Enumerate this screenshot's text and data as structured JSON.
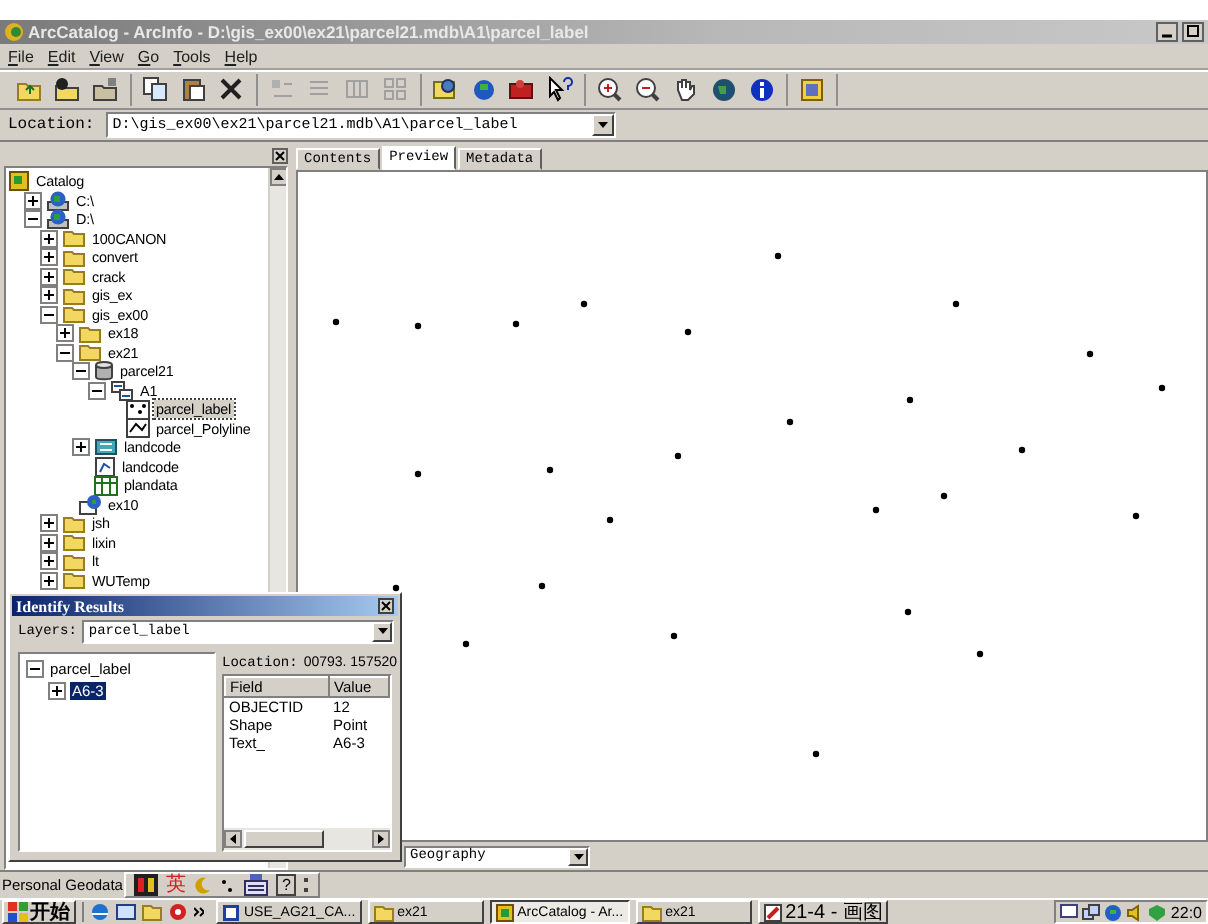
{
  "window": {
    "title": "ArcCatalog - ArcInfo - D:\\gis_ex00\\ex21\\parcel21.mdb\\A1\\parcel_label"
  },
  "menu": [
    "File",
    "Edit",
    "View",
    "Go",
    "Tools",
    "Help"
  ],
  "location": {
    "label": "Location:",
    "value": "D:\\gis_ex00\\ex21\\parcel21.mdb\\A1\\parcel_label"
  },
  "tree": [
    {
      "label": "Catalog",
      "kind": "catalog",
      "selected": false,
      "children": [
        {
          "label": "C:\\",
          "kind": "drive",
          "expanded": false,
          "selected": false
        },
        {
          "label": "D:\\",
          "kind": "drive",
          "expanded": true,
          "selected": false,
          "children": [
            {
              "label": "100CANON",
              "kind": "folder",
              "expanded": false,
              "selected": false
            },
            {
              "label": "convert",
              "kind": "folder",
              "expanded": false,
              "selected": false
            },
            {
              "label": "crack",
              "kind": "folder",
              "expanded": false,
              "selected": false
            },
            {
              "label": "gis_ex",
              "kind": "folder",
              "expanded": false,
              "selected": false
            },
            {
              "label": "gis_ex00",
              "kind": "folder",
              "expanded": true,
              "selected": false,
              "children": [
                {
                  "label": "ex18",
                  "kind": "folder",
                  "expanded": false,
                  "selected": false
                },
                {
                  "label": "ex21",
                  "kind": "folder",
                  "expanded": true,
                  "selected": false,
                  "children": [
                    {
                      "label": "parcel21",
                      "kind": "database",
                      "expanded": true,
                      "selected": false,
                      "children": [
                        {
                          "label": "A1",
                          "kind": "dataset",
                          "expanded": true,
                          "selected": false,
                          "children": [
                            {
                              "label": "parcel_label",
                              "kind": "points",
                              "selected": true
                            },
                            {
                              "label": "parcel_Polyline",
                              "kind": "lines",
                              "selected": false
                            }
                          ]
                        }
                      ]
                    },
                    {
                      "label": "landcode",
                      "kind": "coverage",
                      "expanded": false,
                      "selected": false
                    },
                    {
                      "label": "landcode",
                      "kind": "shapefile",
                      "selected": false
                    },
                    {
                      "label": "plandata",
                      "kind": "table",
                      "selected": false
                    }
                  ]
                },
                {
                  "label": "ex10",
                  "kind": "map",
                  "selected": false
                }
              ]
            },
            {
              "label": "jsh",
              "kind": "folder",
              "expanded": false,
              "selected": false
            },
            {
              "label": "lixin",
              "kind": "folder",
              "expanded": false,
              "selected": false
            },
            {
              "label": "lt",
              "kind": "folder",
              "expanded": false,
              "selected": false
            },
            {
              "label": "WUTemp",
              "kind": "folder",
              "expanded": false,
              "selected": false
            }
          ]
        }
      ]
    }
  ],
  "tabs": [
    {
      "label": "Contents",
      "selected": false
    },
    {
      "label": "Preview",
      "selected": true
    },
    {
      "label": "Metadata",
      "selected": false
    }
  ],
  "preview_type": {
    "value": "Geography"
  },
  "identify": {
    "title": "Identify Results",
    "layers_label": "Layers:",
    "layer": "parcel_label",
    "tree": [
      {
        "label": "parcel_label",
        "expanded": true,
        "selected": false,
        "children": [
          {
            "label": "A6-3",
            "expanded": false,
            "selected": true
          }
        ]
      }
    ],
    "location_label": "Location:",
    "location": "00793. 157520",
    "columns": [
      "Field",
      "Value"
    ],
    "rows": [
      [
        "OBJECTID",
        "12"
      ],
      [
        "Shape",
        "Point"
      ],
      [
        "Text_",
        "A6-3"
      ]
    ]
  },
  "status_bar": {
    "text": "Personal Geodata"
  },
  "ime": {
    "mode": "英",
    "help": "?"
  },
  "taskbar": {
    "start": "开始",
    "clock": "22:0",
    "tasks": [
      {
        "label": "USE_AG21_CA...",
        "kind": "document",
        "selected": false
      },
      {
        "label": "ex21",
        "kind": "folder",
        "selected": false
      },
      {
        "label": "ArcCatalog - Ar...",
        "kind": "catalog",
        "selected": true
      },
      {
        "label": "ex21",
        "kind": "folder",
        "selected": false
      },
      {
        "label": "21-4 - 画图",
        "kind": "paint",
        "selected": false
      }
    ]
  }
}
